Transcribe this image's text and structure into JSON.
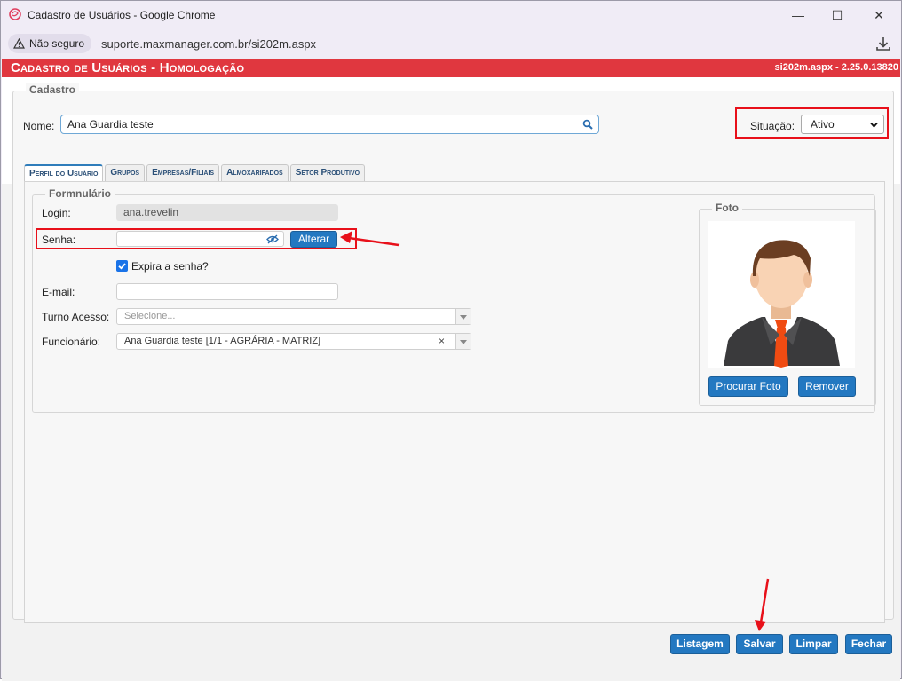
{
  "browser": {
    "window_title": "Cadastro de Usuários - Google Chrome",
    "security_label": "Não seguro",
    "url": "suporte.maxmanager.com.br/si202m.aspx"
  },
  "app": {
    "title": "Cadastro de Usuários - Homologação",
    "version": "si202m.aspx - 2.25.0.13820",
    "accent_color": "#e0373f"
  },
  "cadastro": {
    "legend": "Cadastro",
    "nome_label": "Nome:",
    "nome_value": "Ana Guardia teste",
    "situacao_label": "Situação:",
    "situacao_value": "Ativo"
  },
  "tabs": [
    {
      "label": "Perfil do Usuário",
      "active": true
    },
    {
      "label": "Grupos",
      "active": false
    },
    {
      "label": "Empresas/Filiais",
      "active": false
    },
    {
      "label": "Almoxarifados",
      "active": false
    },
    {
      "label": "Setor Produtivo",
      "active": false
    }
  ],
  "form": {
    "legend": "Formnulário",
    "login_label": "Login:",
    "login_value": "ana.trevelin",
    "senha_label": "Senha:",
    "alterar_label": "Alterar",
    "expira_label": "Expira a senha?",
    "expira_checked": true,
    "email_label": "E-mail:",
    "email_value": "",
    "turno_label": "Turno Acesso:",
    "turno_placeholder": "Selecione...",
    "funcionario_label": "Funcionário:",
    "funcionario_value": "Ana Guardia teste [1/1 - AGRÁRIA - MATRIZ]",
    "clear_symbol": "×"
  },
  "foto": {
    "legend": "Foto",
    "procurar_label": "Procurar Foto",
    "remover_label": "Remover"
  },
  "footer": {
    "listagem_label": "Listagem",
    "salvar_label": "Salvar",
    "limpar_label": "Limpar",
    "fechar_label": "Fechar"
  },
  "window_controls": {
    "minimize": "—",
    "maximize": "☐",
    "close": "✕"
  }
}
